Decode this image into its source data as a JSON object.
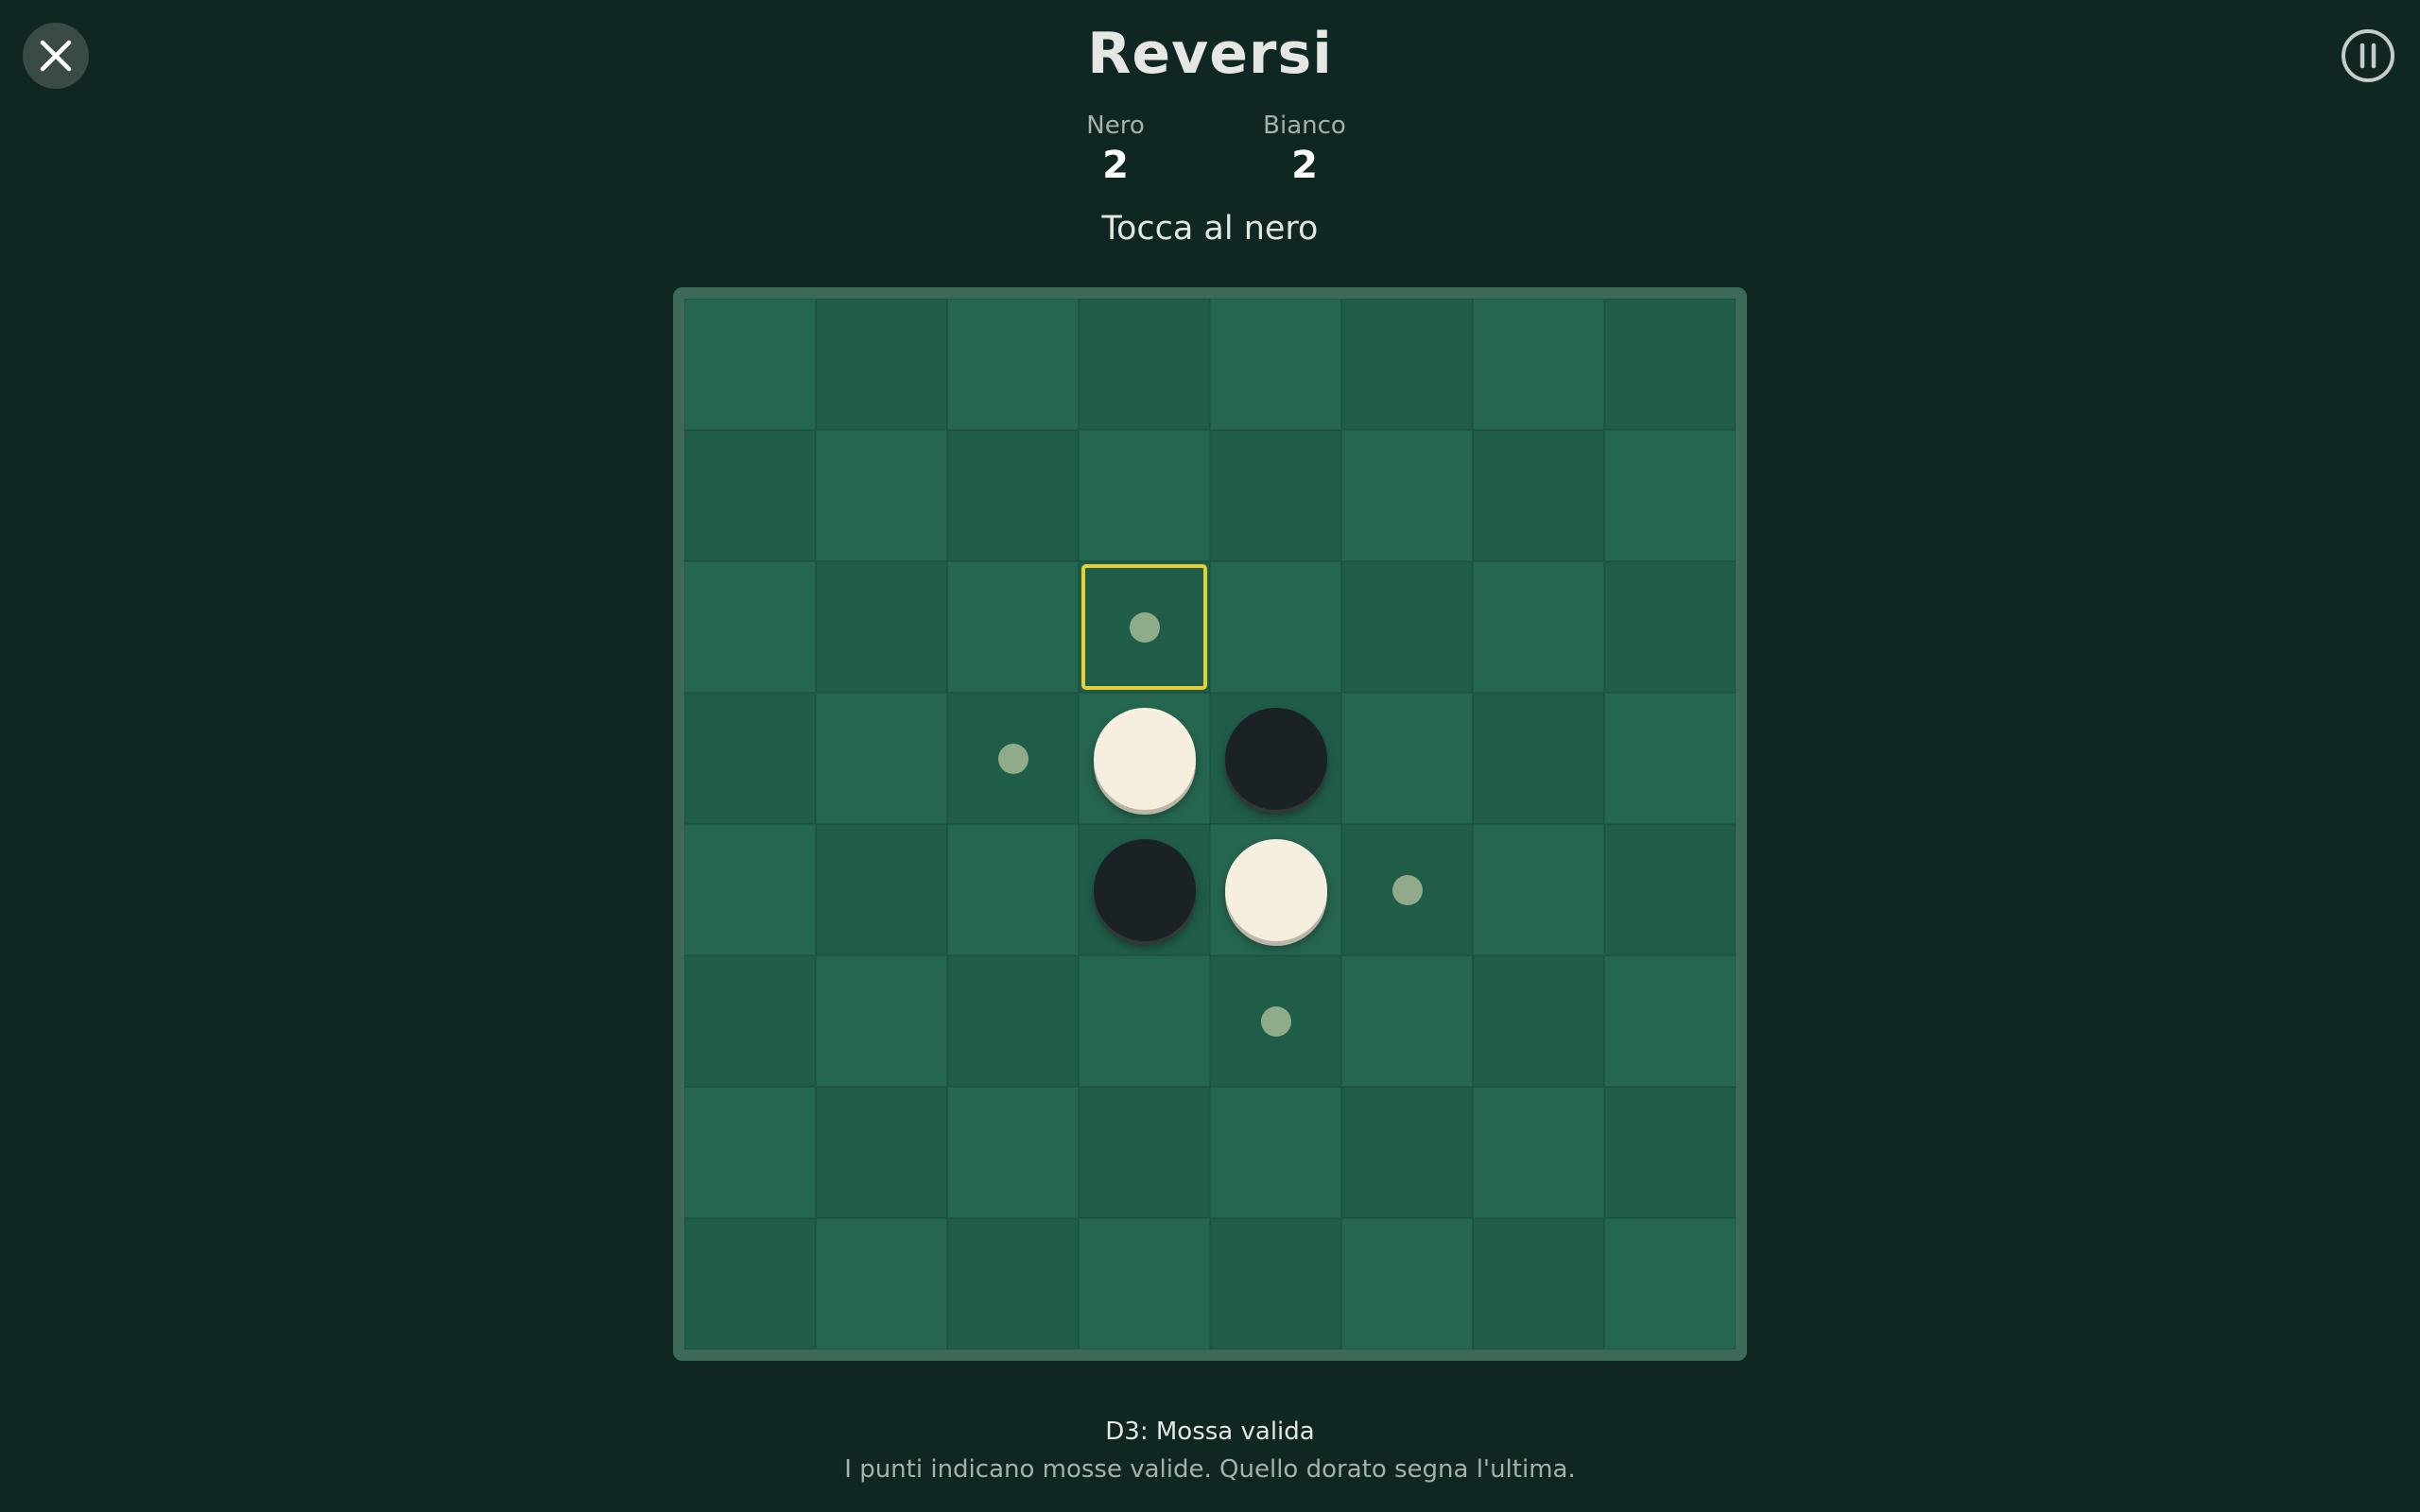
{
  "header": {
    "title": "Reversi",
    "close_icon": "close-icon",
    "pause_icon": "pause-icon"
  },
  "score": {
    "black_label": "Nero",
    "black_value": "2",
    "white_label": "Bianco",
    "white_value": "2"
  },
  "turn_text": "Tocca al nero",
  "board": {
    "rows": 8,
    "cols": 8,
    "discs": [
      {
        "row": 3,
        "col": 3,
        "color": "white"
      },
      {
        "row": 3,
        "col": 4,
        "color": "black"
      },
      {
        "row": 4,
        "col": 3,
        "color": "black"
      },
      {
        "row": 4,
        "col": 4,
        "color": "white"
      }
    ],
    "valid_moves": [
      {
        "row": 2,
        "col": 3
      },
      {
        "row": 3,
        "col": 2
      },
      {
        "row": 4,
        "col": 5
      },
      {
        "row": 5,
        "col": 4
      }
    ],
    "highlighted": {
      "row": 2,
      "col": 3
    },
    "colors": {
      "light": "#256650",
      "dark": "#205d49",
      "highlight": "#e6cf36",
      "hint": "#8fab8a"
    }
  },
  "footer": {
    "status": "D3: Mossa valida",
    "help": "I punti indicano mosse valide. Quello dorato segna l'ultima."
  }
}
